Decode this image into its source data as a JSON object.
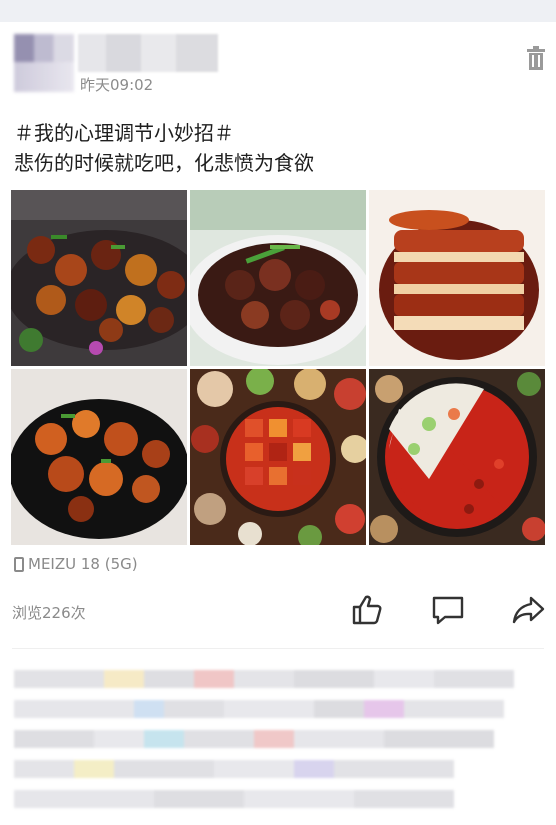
{
  "header": {
    "timestamp": "昨天09:02"
  },
  "post": {
    "line1": "＃我的心理调节小妙招＃",
    "line2": "悲伤的时候就吃吧，化悲愤为食欲"
  },
  "footer": {
    "device": "MEIZU 18 (5G)",
    "views": "浏览226次"
  },
  "icons": {
    "delete": "trash-icon",
    "device": "phone-icon",
    "like": "thumbs-up-icon",
    "comment": "comment-icon",
    "share": "share-icon"
  },
  "colors": {
    "meta_text": "#8c8c8c",
    "body_text": "#1e1e1e",
    "top_band": "#eef0f4"
  }
}
